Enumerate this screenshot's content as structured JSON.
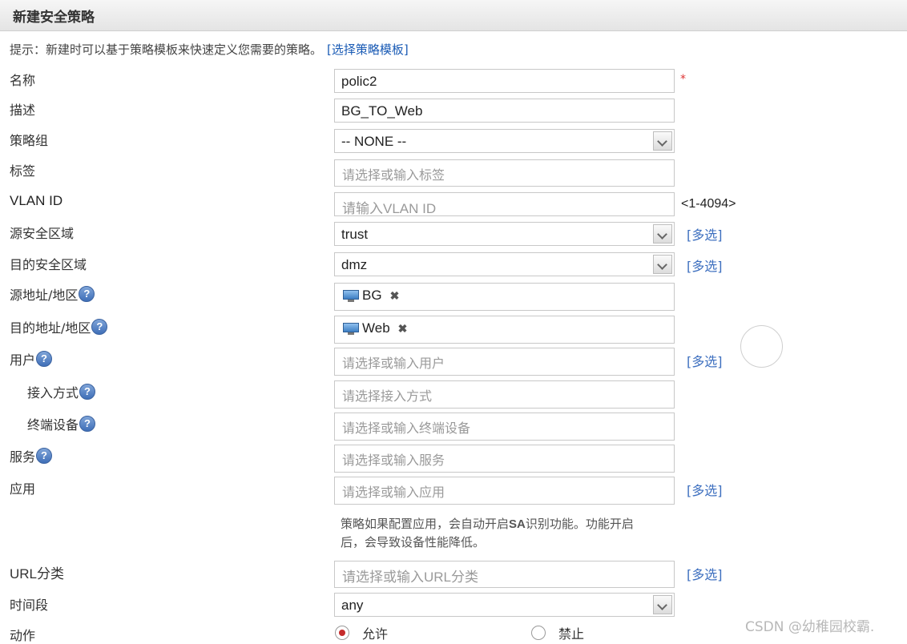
{
  "title": "新建安全策略",
  "hint": {
    "text": "提示：新建时可以基于策略模板来快速定义您需要的策略。",
    "link": "[选择策略模板]"
  },
  "labels": {
    "name": "名称",
    "desc": "描述",
    "group": "策略组",
    "tag": "标签",
    "vlan": "VLAN ID",
    "src_zone": "源安全区域",
    "dst_zone": "目的安全区域",
    "src_addr": "源地址/地区",
    "dst_addr": "目的地址/地区",
    "user": "用户",
    "access": "接入方式",
    "terminal": "终端设备",
    "service": "服务",
    "app": "应用",
    "url": "URL分类",
    "time": "时间段",
    "action": "动作"
  },
  "help_glyph": "?",
  "fields": {
    "name_value": "polic2",
    "required_mark": "*",
    "desc_value": "BG_TO_Web",
    "group_value": "-- NONE --",
    "tag_placeholder": "请选择或输入标签",
    "vlan_placeholder": "请输入VLAN ID",
    "vlan_range": "<1-4094>",
    "src_zone_value": "trust",
    "dst_zone_value": "dmz",
    "src_addr_tag": "BG",
    "dst_addr_tag": "Web",
    "remove_glyph": "✖",
    "user_placeholder": "请选择或输入用户",
    "access_placeholder": "请选择接入方式",
    "terminal_placeholder": "请选择或输入终端设备",
    "service_placeholder": "请选择或输入服务",
    "app_placeholder": "请选择或输入应用",
    "url_placeholder": "请选择或输入URL分类",
    "time_value": "any"
  },
  "multi_select": "[多选]",
  "app_note": {
    "line1_a": "策略如果配置应用，会自动开启",
    "line1_b": "SA",
    "line1_c": "识别功能。功能开启",
    "line2": "后，会导致设备性能降低。"
  },
  "action": {
    "allow": "允许",
    "deny": "禁止",
    "selected": "allow"
  },
  "watermark": "CSDN @幼稚园校霸."
}
